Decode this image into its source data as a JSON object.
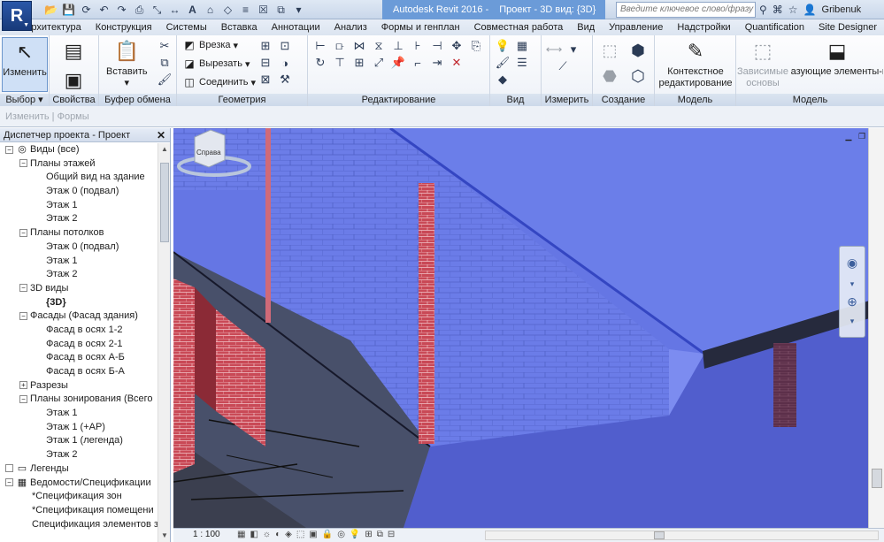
{
  "titlebar": {
    "app_name": "Autodesk Revit 2016 -",
    "doc_title": "Проект - 3D вид: {3D}",
    "search_placeholder": "Введите ключевое слово/фразу",
    "user": "Gribenuk"
  },
  "tabs": [
    "Архитектура",
    "Конструкция",
    "Системы",
    "Вставка",
    "Аннотации",
    "Анализ",
    "Формы и генплан",
    "Совместная работа",
    "Вид",
    "Управление",
    "Надстройки",
    "Quantification",
    "Site Designer"
  ],
  "ribbon": {
    "select": {
      "button": "Изменить",
      "panel": "Выбор"
    },
    "properties": {
      "panel": "Свойства"
    },
    "clipboard": {
      "button": "Вставить",
      "panel": "Буфер обмена"
    },
    "geometry": {
      "cut_label": "Врезка",
      "trim_label": "Вырезать",
      "join_label": "Соединить",
      "panel": "Геометрия"
    },
    "modify": {
      "panel": "Редактирование"
    },
    "view": {
      "panel": "Вид"
    },
    "measure": {
      "panel": "Измерить"
    },
    "create": {
      "panel": "Создание"
    },
    "model": {
      "inplace": "Контекстное редактирование",
      "panel": "Модель"
    },
    "model2": {
      "dependent": "Зависимые основы",
      "forms": "Формообразующие элементы-перекрыти",
      "panel": "Модель"
    }
  },
  "options_bar": "Изменить | Формы",
  "browser": {
    "title": "Диспетчер проекта - Проект",
    "nodes": [
      {
        "label": "Виды (все)",
        "level": 0,
        "exp": "−",
        "icon": "views"
      },
      {
        "label": "Планы этажей",
        "level": 1,
        "exp": "−"
      },
      {
        "label": "Общий вид на здание",
        "level": 2
      },
      {
        "label": "Этаж 0 (подвал)",
        "level": 2
      },
      {
        "label": "Этаж 1",
        "level": 2
      },
      {
        "label": "Этаж 2",
        "level": 2
      },
      {
        "label": "Планы потолков",
        "level": 1,
        "exp": "−"
      },
      {
        "label": "Этаж 0 (подвал)",
        "level": 2
      },
      {
        "label": "Этаж 1",
        "level": 2
      },
      {
        "label": "Этаж 2",
        "level": 2
      },
      {
        "label": "3D виды",
        "level": 1,
        "exp": "−"
      },
      {
        "label": "{3D}",
        "level": 2,
        "bold": true
      },
      {
        "label": "Фасады (Фасад здания)",
        "level": 1,
        "exp": "−"
      },
      {
        "label": "Фасад в осях 1-2",
        "level": 2
      },
      {
        "label": "Фасад в осях 2-1",
        "level": 2
      },
      {
        "label": "Фасад в осях А-Б",
        "level": 2
      },
      {
        "label": "Фасад в осях Б-А",
        "level": 2
      },
      {
        "label": "Разрезы",
        "level": 1,
        "exp": "+"
      },
      {
        "label": "Планы зонирования (Всего",
        "level": 1,
        "exp": "−"
      },
      {
        "label": "Этаж 1",
        "level": 2
      },
      {
        "label": "Этаж 1 (+АР)",
        "level": 2
      },
      {
        "label": "Этаж 1 (легенда)",
        "level": 2
      },
      {
        "label": "Этаж 2",
        "level": 2
      },
      {
        "label": "Легенды",
        "level": 0,
        "exp": " ",
        "icon": "legend"
      },
      {
        "label": "Ведомости/Спецификации",
        "level": 0,
        "exp": "−",
        "icon": "schedule"
      },
      {
        "label": "*Спецификация зон",
        "level": 1
      },
      {
        "label": "*Спецификация помещени",
        "level": 1
      },
      {
        "label": "Спецификация элементов за",
        "level": 1
      }
    ]
  },
  "viewport": {
    "viewcube_label": "Справа"
  },
  "status": {
    "scale": "1 : 100"
  },
  "colors": {
    "accent": "#6b9bd8",
    "viewport_bg": "#6678e6",
    "brick": "#c2424f"
  }
}
